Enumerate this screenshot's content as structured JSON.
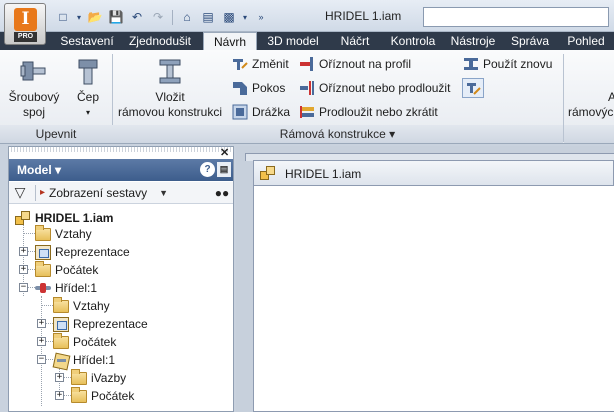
{
  "app": {
    "logo_letter": "I",
    "edition": "PRO"
  },
  "title_bar": {
    "document_title": "HRIDEL 1.iam",
    "search_placeholder": ""
  },
  "quick_access": [
    "new-icon",
    "open-icon",
    "save-icon",
    "undo-icon",
    "redo-icon",
    "home-icon",
    "properties-icon",
    "appearance-icon",
    "more-icon"
  ],
  "ribbon_tabs": [
    {
      "label": "Sestavení"
    },
    {
      "label": "Zjednodušit"
    },
    {
      "label": "Návrh",
      "active": true
    },
    {
      "label": "3D model"
    },
    {
      "label": "Náčrt"
    },
    {
      "label": "Kontrola"
    },
    {
      "label": "Nástroje"
    },
    {
      "label": "Správa"
    },
    {
      "label": "Pohled"
    }
  ],
  "ribbon": {
    "upevnit": {
      "bolted": "Šroubový\nspoj",
      "pin": "Čep",
      "group_label": "Upevnit"
    },
    "frame": {
      "insert": "Vložit\nrámovou konstrukci",
      "change": "Změnit",
      "miter": "Pokos",
      "notch": "Drážka",
      "trim_to_profile": "Oříznout na profil",
      "trim_extend": "Oříznout nebo prodloužit",
      "lengthen_shorten": "Prodloužit nebo zkrátit",
      "reuse": "Použít znovu",
      "group_label": "Rámová konstrukce ▾"
    },
    "cut_right": {
      "line1": "A",
      "line2": "rámovýc"
    }
  },
  "browser": {
    "title": "Model ▾",
    "help": "?",
    "menu": "▤",
    "view_label": "Zobrazení sestavy",
    "tree": [
      {
        "label": "HRIDEL 1.iam",
        "icon": "assembly-icon"
      },
      {
        "label": "Vztahy",
        "icon": "folder-icon"
      },
      {
        "label": "Reprezentace",
        "icon": "representation-icon"
      },
      {
        "label": "Počátek",
        "icon": "folder-icon"
      },
      {
        "label": "Hřídel:1",
        "icon": "shaft-icon"
      },
      {
        "label": "Vztahy",
        "icon": "folder-icon"
      },
      {
        "label": "Reprezentace",
        "icon": "representation-icon"
      },
      {
        "label": "Počátek",
        "icon": "folder-icon"
      },
      {
        "label": "Hřídel:1",
        "icon": "part-icon"
      },
      {
        "label": "iVazby",
        "icon": "folder-icon"
      },
      {
        "label": "Počátek",
        "icon": "folder-icon"
      }
    ]
  },
  "document": {
    "tab_label": "HRIDEL 1.iam"
  }
}
